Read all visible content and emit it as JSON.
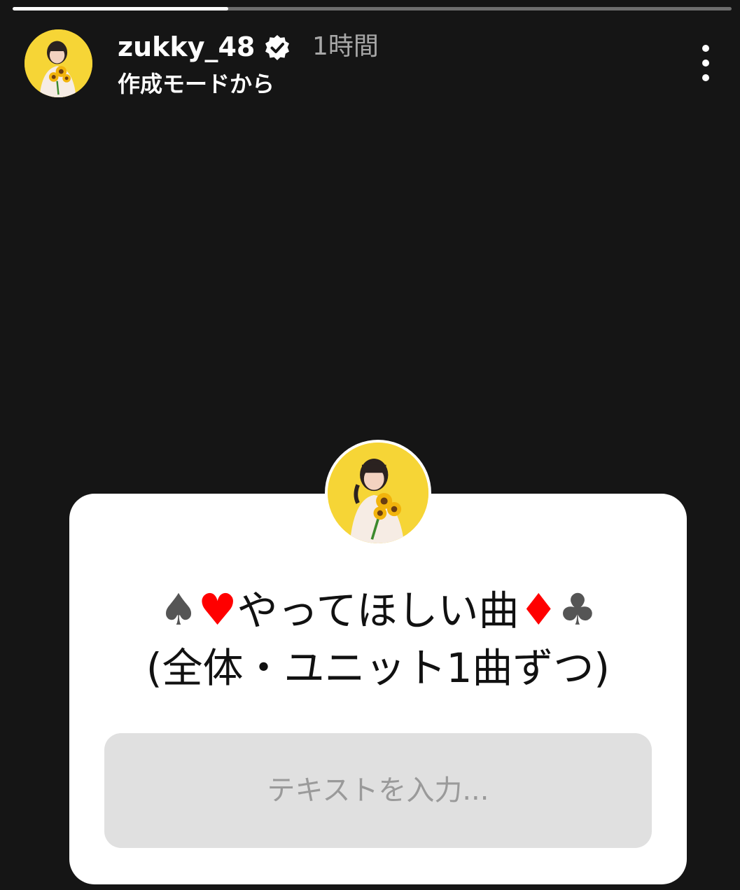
{
  "progress": {
    "fraction": 0.3
  },
  "header": {
    "avatar_icon": "profile-avatar",
    "username": "zukky_48",
    "verified_icon": "verified-badge-icon",
    "timestamp": "1時間",
    "subtitle": "作成モードから",
    "more_icon": "more-vertical-icon"
  },
  "sticker": {
    "avatar_icon": "profile-avatar",
    "question": {
      "suit_spade": "♠",
      "suit_heart": "♥",
      "title": "やってほしい曲",
      "suit_diamond": "♦",
      "suit_club": "♣",
      "line2": "(全体・ユニット1曲ずつ)"
    },
    "answer_placeholder": "テキストを入力..."
  },
  "colors": {
    "background": "#151515",
    "card": "#ffffff",
    "answer_box": "#e0e0e0",
    "suit_red": "#ff0000",
    "suit_black": "#555555",
    "avatar_bg": "#f6d536"
  }
}
